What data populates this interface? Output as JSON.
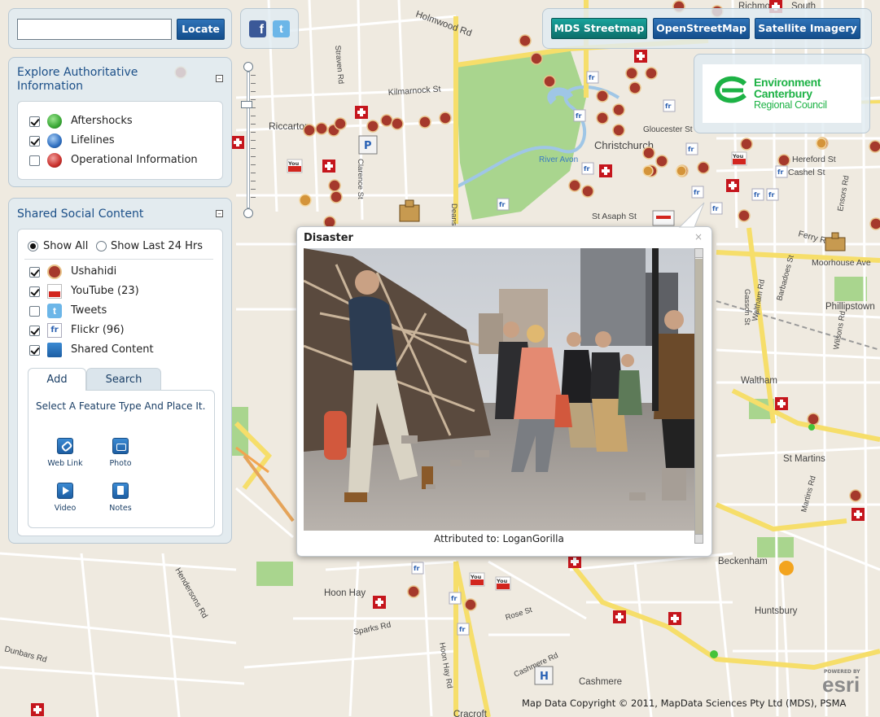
{
  "search": {
    "value": "",
    "locate_label": "Locate"
  },
  "basemaps": {
    "mds": "MDS Streetmap",
    "osm": "OpenStreetMap",
    "sat": "Satellite Imagery"
  },
  "logo": {
    "line1": "Environment",
    "line2": "Canterbury",
    "line3": "Regional Council"
  },
  "explore": {
    "title": "Explore Authoritative Information",
    "layers": [
      {
        "label": "Aftershocks",
        "checked": true,
        "color": "#3aa836"
      },
      {
        "label": "Lifelines",
        "checked": true,
        "color": "#2f6fc0"
      },
      {
        "label": "Operational Information",
        "checked": false,
        "color": "#c9302c"
      }
    ]
  },
  "social": {
    "title": "Shared Social Content",
    "show_all": "Show All",
    "show_last": "Show Last 24 Hrs",
    "layers": [
      {
        "label": "Ushahidi",
        "checked": true,
        "icon": "ushahidi-icon"
      },
      {
        "label": "YouTube (23)",
        "checked": true,
        "icon": "youtube-icon"
      },
      {
        "label": "Tweets",
        "checked": false,
        "icon": "twitter-icon"
      },
      {
        "label": "Flickr (96)",
        "checked": true,
        "icon": "flickr-icon"
      },
      {
        "label": "Shared Content",
        "checked": true,
        "icon": "shared-content-icon"
      }
    ],
    "tab_add": "Add",
    "tab_search": "Search",
    "instruction": "Select A Feature Type And Place It.",
    "tools": [
      "Web Link",
      "Photo",
      "Video",
      "Notes"
    ]
  },
  "popup": {
    "title": "Disaster",
    "close": "×",
    "attribution": "Attributed to: LoganGorilla"
  },
  "map": {
    "labels": [
      {
        "t": "Holmwood Rd"
      },
      {
        "t": "Kilmarnock St"
      },
      {
        "t": "Riccarton"
      },
      {
        "t": "Christchurch"
      },
      {
        "t": "River Avon"
      },
      {
        "t": "Gloucester St"
      },
      {
        "t": "Hereford St"
      },
      {
        "t": "Cashel St"
      },
      {
        "t": "St Asaph St"
      },
      {
        "t": "Ferry Rd"
      },
      {
        "t": "Moorhouse Ave"
      },
      {
        "t": "Phillipstown"
      },
      {
        "t": "Waltham"
      },
      {
        "t": "St Martins"
      },
      {
        "t": "Beckenham"
      },
      {
        "t": "Huntsbury"
      },
      {
        "t": "Hoon Hay"
      },
      {
        "t": "Cashmere"
      },
      {
        "t": "Cracroft"
      },
      {
        "t": "Sparks Rd"
      },
      {
        "t": "Hendersons Rd"
      },
      {
        "t": "Dunbars Rd"
      },
      {
        "t": "Richmond"
      },
      {
        "t": "South"
      },
      {
        "t": "Clarence St"
      },
      {
        "t": "Straven Rd"
      },
      {
        "t": "Waltham Rd"
      },
      {
        "t": "Martins Rd"
      },
      {
        "t": "Rose St"
      },
      {
        "t": "Cashmere Rd"
      },
      {
        "t": "Hoon Hay Rd"
      },
      {
        "t": "Deans Ave"
      },
      {
        "t": "Ensors Rd"
      },
      {
        "t": "Wilsons Rd"
      },
      {
        "t": "Gasson St"
      },
      {
        "t": "Barbadoes St"
      }
    ]
  },
  "copyright": "Map Data Copyright © 2011, MapData Sciences Pty Ltd (MDS), PSMA",
  "esri": {
    "powered": "POWERED BY",
    "name": "esri"
  }
}
